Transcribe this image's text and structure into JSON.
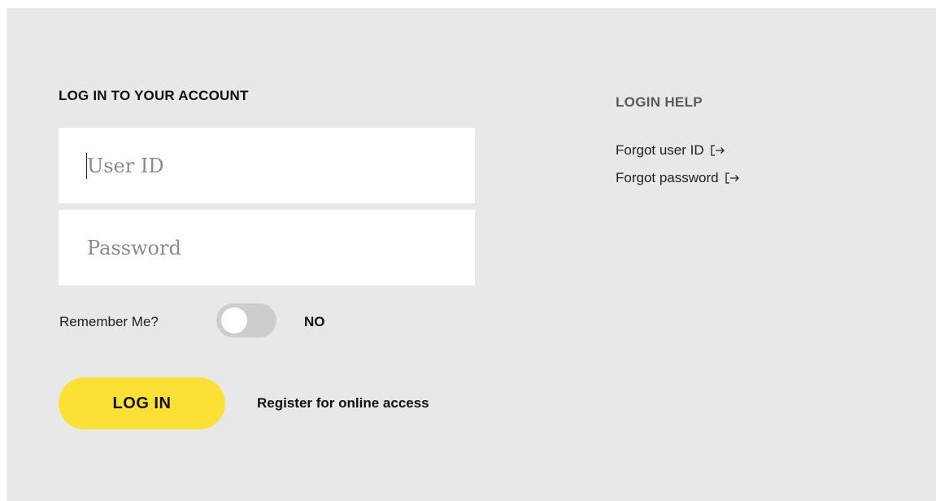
{
  "login": {
    "title": "LOG IN TO YOUR ACCOUNT",
    "user_id_placeholder": "User ID",
    "password_placeholder": "Password",
    "remember_label": "Remember Me?",
    "remember_state": "NO",
    "login_button": "LOG IN",
    "register_link": "Register for online access"
  },
  "help": {
    "title": "LOGIN HELP",
    "links": [
      {
        "label": "Forgot user ID",
        "icon": "external-link-icon"
      },
      {
        "label": "Forgot password",
        "icon": "external-link-icon"
      }
    ]
  },
  "colors": {
    "panel_bg": "#e8e8e8",
    "button_accent": "#fbe035",
    "toggle_off": "#cdcdcd"
  }
}
